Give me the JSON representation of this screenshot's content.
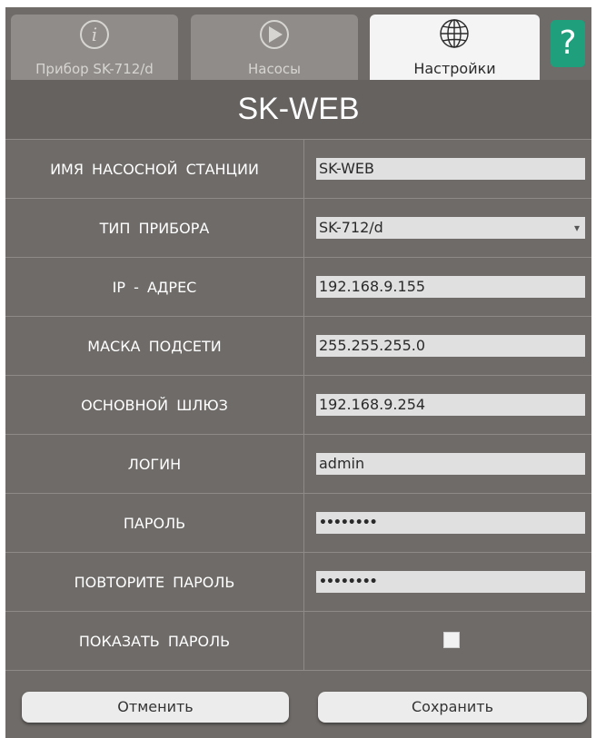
{
  "tabs": {
    "device": {
      "label": "Прибор SK-712/d",
      "icon": "info-icon"
    },
    "pumps": {
      "label": "Насосы",
      "icon": "play-icon"
    },
    "settings": {
      "label": "Настройки",
      "icon": "globe-icon"
    }
  },
  "help": {
    "label": "?"
  },
  "title": "SK-WEB",
  "form": {
    "station_name": {
      "label": "ИМЯ НАСОСНОЙ СТАНЦИИ",
      "value": "SK-WEB"
    },
    "device_type": {
      "label": "ТИП ПРИБОРА",
      "value": "SK-712/d"
    },
    "ip_address": {
      "label": "IP - АДРЕС",
      "value": "192.168.9.155"
    },
    "subnet_mask": {
      "label": "МАСКА ПОДСЕТИ",
      "value": "255.255.255.0"
    },
    "gateway": {
      "label": "ОСНОВНОЙ ШЛЮЗ",
      "value": "192.168.9.254"
    },
    "login": {
      "label": "ЛОГИН",
      "value": "admin"
    },
    "password": {
      "label": "ПАРОЛЬ",
      "value": "••••••••"
    },
    "password_repeat": {
      "label": "ПОВТОРИТЕ ПАРОЛЬ",
      "value": "••••••••"
    },
    "show_password": {
      "label": "ПОКАЗАТЬ ПАРОЛЬ",
      "checked": false
    }
  },
  "buttons": {
    "cancel": "Отменить",
    "save": "Сохранить"
  },
  "colors": {
    "background": "#6e6b68",
    "tab_inactive": "#8f8c89",
    "tab_active": "#f4f4f4",
    "help_accent": "#1f9f7c"
  }
}
